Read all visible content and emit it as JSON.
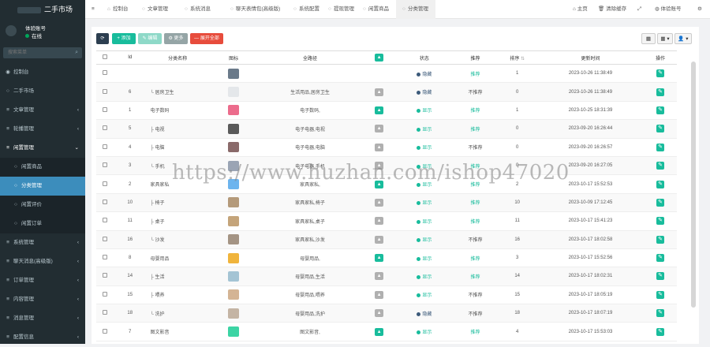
{
  "brand": {
    "title": "二手市场"
  },
  "user": {
    "name": "体验账号",
    "status": "在线"
  },
  "search": {
    "placeholder": "搜索菜单"
  },
  "sidebar": {
    "items": [
      {
        "icon": "◉",
        "label": "控制台",
        "arrow": ""
      },
      {
        "icon": "○",
        "label": "二手市场",
        "arrow": ""
      },
      {
        "icon": "≡",
        "label": "文章管理",
        "arrow": "‹"
      },
      {
        "icon": "≡",
        "label": "轮播管理",
        "arrow": "‹"
      },
      {
        "icon": "≡",
        "label": "闲置管理",
        "arrow": "⌄"
      },
      {
        "icon": "○",
        "label": "闲置商品",
        "arrow": ""
      },
      {
        "icon": "○",
        "label": "分类管理",
        "arrow": ""
      },
      {
        "icon": "○",
        "label": "闲置评价",
        "arrow": ""
      },
      {
        "icon": "○",
        "label": "闲置订单",
        "arrow": ""
      },
      {
        "icon": "≡",
        "label": "系统管理",
        "arrow": "‹"
      },
      {
        "icon": "≡",
        "label": "聊天消息(高级版)",
        "arrow": "‹"
      },
      {
        "icon": "≡",
        "label": "订单管理",
        "arrow": "‹"
      },
      {
        "icon": "≡",
        "label": "内容管理",
        "arrow": "‹"
      },
      {
        "icon": "≡",
        "label": "消息管理",
        "arrow": "‹"
      },
      {
        "icon": "≡",
        "label": "配置信息",
        "arrow": "‹"
      }
    ]
  },
  "topbar": {
    "menu_icon": "≡",
    "tabs": [
      {
        "icon": "⌂",
        "label": "控制台"
      },
      {
        "icon": "○",
        "label": "文章管理"
      },
      {
        "icon": "○",
        "label": "系统消息"
      },
      {
        "icon": "○",
        "label": "聊天表情包(高级版)"
      },
      {
        "icon": "○",
        "label": "系统配置"
      },
      {
        "icon": "○",
        "label": "提现管理"
      },
      {
        "icon": "○",
        "label": "闲置商品"
      },
      {
        "icon": "○",
        "label": "分类管理"
      }
    ],
    "home": "主页",
    "clear_cache": "清除缓存",
    "account": "体验账号"
  },
  "toolbar": {
    "refresh": "⟳",
    "add": "+ 添加",
    "edit": "✎ 编辑",
    "more": "⚙ 更多",
    "expand_all": "— 展开全部",
    "view_toggle": "▦",
    "columns": "▦ ▾",
    "export": "👤 ▾"
  },
  "table": {
    "headers": [
      "",
      "Id",
      "分类名称",
      "图标",
      "全路径",
      "▲",
      "状态",
      "推荐",
      "排序",
      "更新时间",
      "操作"
    ],
    "rows": [
      {
        "id": "",
        "name": "",
        "icon_color": "#6a7a8a",
        "path": "",
        "arrow_color": "",
        "status": "隐藏",
        "status_color": "#3c5a7a",
        "rec": "推荐",
        "rec_color": "#18bc9c",
        "sort": "1",
        "time": "2023-10-26 11:38:49"
      },
      {
        "id": "6",
        "name": "└ 居房卫生",
        "icon_color": "#e4e7ea",
        "path": "生活用品,居房卫生",
        "arrow_color": "#b0b0b0",
        "status": "隐藏",
        "status_color": "#3c5a7a",
        "rec": "不推荐",
        "rec_color": "#555",
        "sort": "0",
        "time": "2023-10-26 11:38:49"
      },
      {
        "id": "1",
        "name": "电子数码",
        "icon_color": "#ec6c8c",
        "path": "电子数码,",
        "arrow_color": "#18bc9c",
        "status": "显示",
        "status_color": "#18bc9c",
        "rec": "推荐",
        "rec_color": "#18bc9c",
        "sort": "1",
        "time": "2023-10-25 18:31:39"
      },
      {
        "id": "5",
        "name": "├ 电视",
        "icon_color": "#5a5a5a",
        "path": "电子电器,电视",
        "arrow_color": "#b0b0b0",
        "status": "显示",
        "status_color": "#18bc9c",
        "rec": "推荐",
        "rec_color": "#18bc9c",
        "sort": "0",
        "time": "2023-09-20 16:26:44"
      },
      {
        "id": "4",
        "name": "├ 电脑",
        "icon_color": "#8a6a6a",
        "path": "电子电器,电脑",
        "arrow_color": "#b0b0b0",
        "status": "显示",
        "status_color": "#18bc9c",
        "rec": "不推荐",
        "rec_color": "#555",
        "sort": "0",
        "time": "2023-09-20 16:26:57"
      },
      {
        "id": "3",
        "name": "└ 手机",
        "icon_color": "#9aa4b4",
        "path": "电子电器,手机",
        "arrow_color": "#b0b0b0",
        "status": "显示",
        "status_color": "#18bc9c",
        "rec": "推荐",
        "rec_color": "#18bc9c",
        "sort": "0",
        "time": "2023-09-20 16:27:05"
      },
      {
        "id": "2",
        "name": "家具家私",
        "icon_color": "#6cb4ee",
        "path": "家具家私,",
        "arrow_color": "#18bc9c",
        "status": "显示",
        "status_color": "#18bc9c",
        "rec": "推荐",
        "rec_color": "#18bc9c",
        "sort": "2",
        "time": "2023-10-17 15:52:53"
      },
      {
        "id": "10",
        "name": "├ 椅子",
        "icon_color": "#b49a7a",
        "path": "家具家私,椅子",
        "arrow_color": "#b0b0b0",
        "status": "显示",
        "status_color": "#18bc9c",
        "rec": "推荐",
        "rec_color": "#18bc9c",
        "sort": "10",
        "time": "2023-10-09 17:12:45"
      },
      {
        "id": "11",
        "name": "├ 桌子",
        "icon_color": "#c4a47a",
        "path": "家具家私,桌子",
        "arrow_color": "#b0b0b0",
        "status": "显示",
        "status_color": "#18bc9c",
        "rec": "推荐",
        "rec_color": "#18bc9c",
        "sort": "11",
        "time": "2023-10-17 15:41:23"
      },
      {
        "id": "16",
        "name": "└ 沙发",
        "icon_color": "#a49484",
        "path": "家具家私,沙发",
        "arrow_color": "#b0b0b0",
        "status": "显示",
        "status_color": "#18bc9c",
        "rec": "不推荐",
        "rec_color": "#555",
        "sort": "16",
        "time": "2023-10-17 18:02:58"
      },
      {
        "id": "8",
        "name": "母婴用品",
        "icon_color": "#f0b43c",
        "path": "母婴用品,",
        "arrow_color": "#18bc9c",
        "status": "显示",
        "status_color": "#18bc9c",
        "rec": "推荐",
        "rec_color": "#18bc9c",
        "sort": "3",
        "time": "2023-10-17 15:52:56"
      },
      {
        "id": "14",
        "name": "├ 生活",
        "icon_color": "#a4c4d4",
        "path": "母婴用品,生活",
        "arrow_color": "#b0b0b0",
        "status": "显示",
        "status_color": "#18bc9c",
        "rec": "推荐",
        "rec_color": "#18bc9c",
        "sort": "14",
        "time": "2023-10-17 18:02:31"
      },
      {
        "id": "15",
        "name": "├ 喂养",
        "icon_color": "#d4b494",
        "path": "母婴用品,喂养",
        "arrow_color": "#b0b0b0",
        "status": "显示",
        "status_color": "#18bc9c",
        "rec": "不推荐",
        "rec_color": "#555",
        "sort": "15",
        "time": "2023-10-17 18:05:19"
      },
      {
        "id": "18",
        "name": "└ 洗护",
        "icon_color": "#c4b4a4",
        "path": "母婴用品,洗护",
        "arrow_color": "#b0b0b0",
        "status": "隐藏",
        "status_color": "#3c5a7a",
        "rec": "不推荐",
        "rec_color": "#555",
        "sort": "18",
        "time": "2023-10-17 18:07:19"
      },
      {
        "id": "7",
        "name": "图文影音",
        "icon_color": "#3cd4a4",
        "path": "图文影音,",
        "arrow_color": "#18bc9c",
        "status": "显示",
        "status_color": "#18bc9c",
        "rec": "推荐",
        "rec_color": "#18bc9c",
        "sort": "4",
        "time": "2023-10-17 15:53:03"
      }
    ]
  },
  "watermark": "https://www.huzhan.com/ishop47020"
}
